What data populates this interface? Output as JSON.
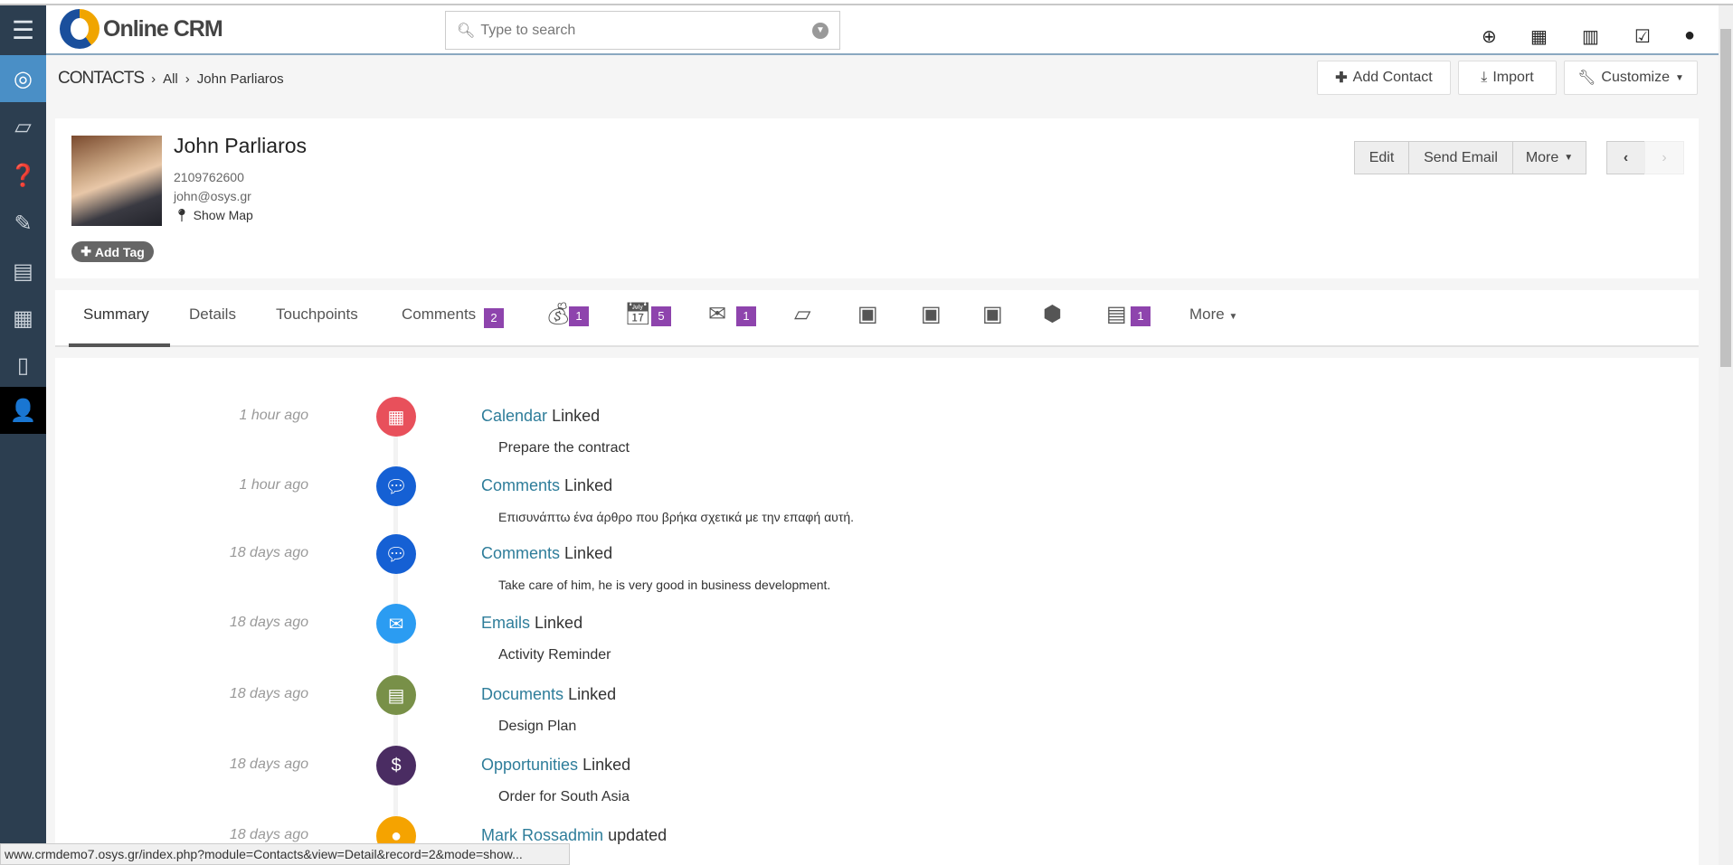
{
  "app": {
    "logo": "Online CRM",
    "search_placeholder": "Type to search"
  },
  "topbar_icons": [
    "plus-circle-icon",
    "calendar-icon",
    "bar-chart-icon",
    "checkbox-icon",
    "user-icon"
  ],
  "breadcrumb": {
    "module": "CONTACTS",
    "all": "All",
    "record": "John Parliaros"
  },
  "actions": {
    "add_contact": "Add Contact",
    "import": "Import",
    "customize": "Customize"
  },
  "contact": {
    "name": "John Parliaros",
    "phone": "2109762600",
    "email": "john@osys.gr",
    "show_map": "Show Map",
    "add_tag": "Add Tag"
  },
  "record_buttons": {
    "edit": "Edit",
    "send_email": "Send Email",
    "more": "More"
  },
  "tabs": {
    "summary": "Summary",
    "details": "Details",
    "touchpoints": "Touchpoints",
    "comments": "Comments",
    "comments_count": "2",
    "opportunities_count": "1",
    "calendar_count": "5",
    "emails_count": "1",
    "documents_count": "1",
    "more": "More"
  },
  "timeline": [
    {
      "time": "1 hour ago",
      "module": "Calendar",
      "action": "Linked",
      "detail": "Prepare the contract",
      "color": "#e8505b"
    },
    {
      "time": "1 hour ago",
      "module": "Comments",
      "action": "Linked",
      "detail": "Επισυνάπτω ένα άρθρο που βρήκα σχετικά με την επαφή αυτή.",
      "color": "#1560d4"
    },
    {
      "time": "18 days ago",
      "module": "Comments",
      "action": "Linked",
      "detail": "Take care of him, he is very good in business development.",
      "color": "#1560d4"
    },
    {
      "time": "18 days ago",
      "module": "Emails",
      "action": "Linked",
      "detail": "Activity Reminder",
      "color": "#2b9cf2"
    },
    {
      "time": "18 days ago",
      "module": "Documents",
      "action": "Linked",
      "detail": "Design Plan",
      "color": "#789048"
    },
    {
      "time": "18 days ago",
      "module": "Opportunities",
      "action": "Linked",
      "detail": "Order for South Asia",
      "color": "#4a2c62"
    },
    {
      "time": "18 days ago",
      "module": "Mark Rossadmin",
      "action": "updated",
      "detail": "",
      "color": "#f5a300"
    }
  ],
  "status_url": "www.crmdemo7.osys.gr/index.php?module=Contacts&view=Detail&record=2&mode=show..."
}
